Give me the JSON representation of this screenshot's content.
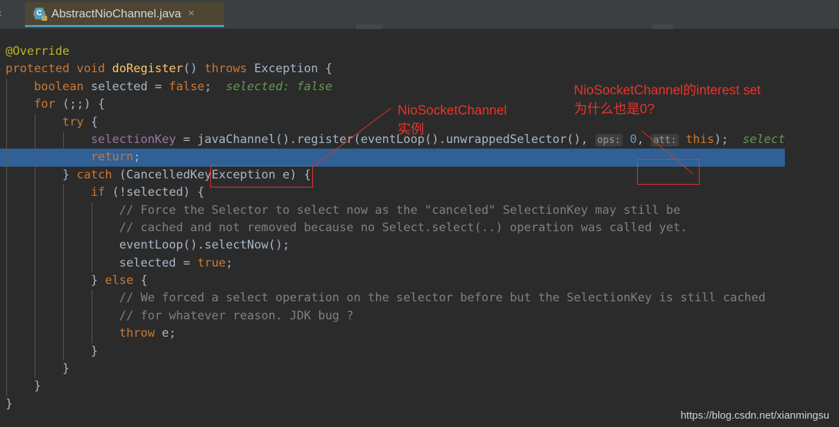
{
  "window": {
    "background_color": "#2b2b2b"
  },
  "tabbar": {
    "partial_tab": {
      "label": "a",
      "close_glyph": "×"
    },
    "active_tab": {
      "label": "AbstractNioChannel.java",
      "icon": "java-class-locked-icon",
      "icon_letter": "C",
      "close_glyph": "×",
      "underline_color": "#4a9ec0",
      "background_color": "#4e4633"
    }
  },
  "editor": {
    "selected_line_color": "#2f6096",
    "lines": [
      {
        "id": "line-override",
        "indent": 0,
        "selected": false,
        "tokens": [
          {
            "cls": "anno",
            "text": "@Override"
          }
        ]
      },
      {
        "id": "line-signature",
        "indent": 0,
        "selected": false,
        "tokens": [
          {
            "cls": "kw",
            "text": "protected "
          },
          {
            "cls": "kw",
            "text": "void "
          },
          {
            "cls": "fn",
            "text": "doRegister"
          },
          {
            "cls": "plain",
            "text": "() "
          },
          {
            "cls": "kw",
            "text": "throws "
          },
          {
            "cls": "plain",
            "text": "Exception {"
          }
        ]
      },
      {
        "id": "line-boolean-selected",
        "indent": 1,
        "selected": false,
        "tokens": [
          {
            "cls": "kw",
            "text": "    boolean "
          },
          {
            "cls": "plain",
            "text": "selected = "
          },
          {
            "cls": "kw",
            "text": "false"
          },
          {
            "cls": "plain",
            "text": ";  "
          },
          {
            "cls": "inlay",
            "text": "selected: false"
          }
        ]
      },
      {
        "id": "line-for",
        "indent": 1,
        "selected": false,
        "tokens": [
          {
            "cls": "kw",
            "text": "    for "
          },
          {
            "cls": "plain",
            "text": "(;;) {"
          }
        ]
      },
      {
        "id": "line-try",
        "indent": 2,
        "selected": false,
        "tokens": [
          {
            "cls": "kw",
            "text": "        try "
          },
          {
            "cls": "plain",
            "text": "{"
          }
        ]
      },
      {
        "id": "line-selectionkey-register",
        "indent": 3,
        "selected": false,
        "tokens": [
          {
            "cls": "field",
            "text": "            selectionKey "
          },
          {
            "cls": "plain",
            "text": "= javaChannel().register(eventLoop().unwrappedSelector(), "
          },
          {
            "cls": "hint",
            "text": "ops:"
          },
          {
            "cls": "num",
            "text": " 0"
          },
          {
            "cls": "plain",
            "text": ", "
          },
          {
            "cls": "hint",
            "text": "att:"
          },
          {
            "cls": "kw",
            "text": " this"
          },
          {
            "cls": "plain",
            "text": ");  "
          },
          {
            "cls": "inlay",
            "text": "select"
          }
        ]
      },
      {
        "id": "line-return",
        "indent": 3,
        "selected": true,
        "tokens": [
          {
            "cls": "kw",
            "text": "            return"
          },
          {
            "cls": "plain",
            "text": ";"
          }
        ]
      },
      {
        "id": "line-catch",
        "indent": 2,
        "selected": false,
        "tokens": [
          {
            "cls": "plain",
            "text": "        } "
          },
          {
            "cls": "kw",
            "text": "catch "
          },
          {
            "cls": "plain",
            "text": "(CancelledKeyException e) {"
          }
        ]
      },
      {
        "id": "line-if-selected",
        "indent": 3,
        "selected": false,
        "tokens": [
          {
            "cls": "kw",
            "text": "            if "
          },
          {
            "cls": "plain",
            "text": "(!selected) {"
          }
        ]
      },
      {
        "id": "line-comment-force",
        "indent": 4,
        "selected": false,
        "tokens": [
          {
            "cls": "comment",
            "text": "                // Force the Selector to select now as the \"canceled\" SelectionKey may still be"
          }
        ]
      },
      {
        "id": "line-comment-cached",
        "indent": 4,
        "selected": false,
        "tokens": [
          {
            "cls": "comment",
            "text": "                // cached and not removed because no Select.select(..) operation was called yet."
          }
        ]
      },
      {
        "id": "line-selectnow",
        "indent": 4,
        "selected": false,
        "tokens": [
          {
            "cls": "plain",
            "text": "                eventLoop().selectNow();"
          }
        ]
      },
      {
        "id": "line-selected-true",
        "indent": 4,
        "selected": false,
        "tokens": [
          {
            "cls": "plain",
            "text": "                selected = "
          },
          {
            "cls": "kw",
            "text": "true"
          },
          {
            "cls": "plain",
            "text": ";"
          }
        ]
      },
      {
        "id": "line-else",
        "indent": 3,
        "selected": false,
        "tokens": [
          {
            "cls": "plain",
            "text": "            } "
          },
          {
            "cls": "kw",
            "text": "else "
          },
          {
            "cls": "plain",
            "text": "{"
          }
        ]
      },
      {
        "id": "line-comment-weforced",
        "indent": 4,
        "selected": false,
        "tokens": [
          {
            "cls": "comment",
            "text": "                // We forced a select operation on the selector before but the SelectionKey is still cached"
          }
        ]
      },
      {
        "id": "line-comment-jdkbug",
        "indent": 4,
        "selected": false,
        "tokens": [
          {
            "cls": "comment",
            "text": "                // for whatever reason. JDK bug ?"
          }
        ]
      },
      {
        "id": "line-throw",
        "indent": 4,
        "selected": false,
        "tokens": [
          {
            "cls": "kw",
            "text": "                throw "
          },
          {
            "cls": "plain",
            "text": "e;"
          }
        ]
      },
      {
        "id": "line-close-else",
        "indent": 3,
        "selected": false,
        "tokens": [
          {
            "cls": "plain",
            "text": "            }"
          }
        ]
      },
      {
        "id": "line-close-catch",
        "indent": 2,
        "selected": false,
        "tokens": [
          {
            "cls": "plain",
            "text": "        }"
          }
        ]
      },
      {
        "id": "line-close-for",
        "indent": 1,
        "selected": false,
        "tokens": [
          {
            "cls": "plain",
            "text": "    }"
          }
        ]
      },
      {
        "id": "line-close-method",
        "indent": 0,
        "selected": false,
        "tokens": [
          {
            "cls": "plain",
            "text": "}"
          }
        ]
      }
    ]
  },
  "annotations": {
    "color": "#e8342a",
    "note_instance": "NioSocketChannel实例",
    "note_interest": "NioSocketChannel的interest set\n为什么也是0?",
    "highlight_javachannel": "javaChannel()",
    "highlight_ops": "ops: 0,"
  },
  "watermark": {
    "text": "https://blog.csdn.net/xianmingsu"
  }
}
